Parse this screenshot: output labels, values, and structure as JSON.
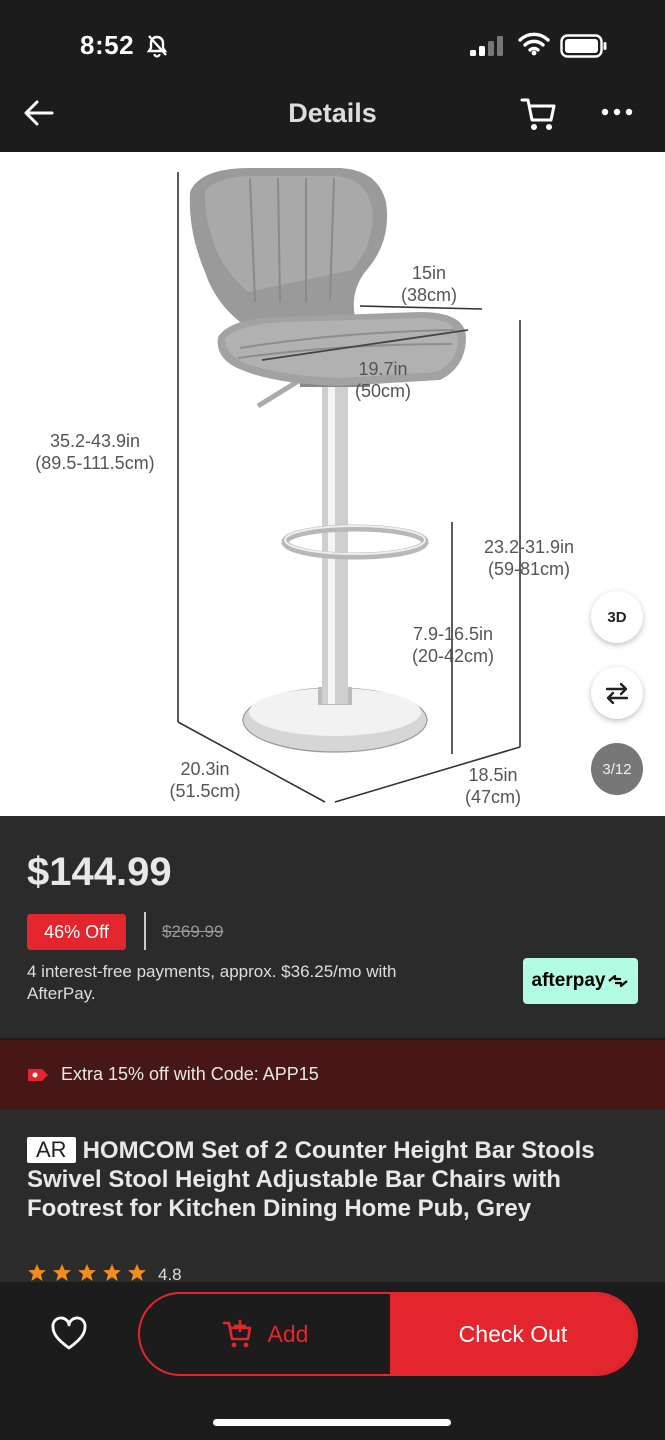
{
  "status_bar": {
    "time": "8:52"
  },
  "nav": {
    "title": "Details"
  },
  "gallery": {
    "dimensions": {
      "overall_height": "35.2-43.9in\n(89.5-111.5cm)",
      "back_width": "15in\n(38cm)",
      "seat_depth": "19.7in\n(50cm)",
      "seat_height": "23.2-31.9in\n(59-81cm)",
      "footrest_height": "7.9-16.5in\n(20-42cm)",
      "base_width": "20.3in\n(51.5cm)",
      "base_depth": "18.5in\n(47cm)"
    },
    "view_3d_label": "3D",
    "counter": "3/12"
  },
  "pricing": {
    "price": "$144.99",
    "discount": "46% Off",
    "original_price": "$269.99",
    "afterpay_text": "4 interest-free payments, approx. $36.25/mo with AfterPay.",
    "afterpay_logo": "afterpay"
  },
  "promo": {
    "text": "Extra 15% off with Code: APP15"
  },
  "product": {
    "badge": "AR",
    "title": "HOMCOM Set of 2 Counter Height Bar Stools Swivel Stool Height Adjustable Bar Chairs with Footrest for Kitchen Dining Home Pub, Grey",
    "rating": "4.8",
    "rating_value": 4.8,
    "star_color": "#f28c1b"
  },
  "actions": {
    "add_label": "Add",
    "checkout_label": "Check Out"
  },
  "colors": {
    "accent": "#e3262e",
    "afterpay_bg": "#b2fce4",
    "promo_bg": "#471717"
  }
}
